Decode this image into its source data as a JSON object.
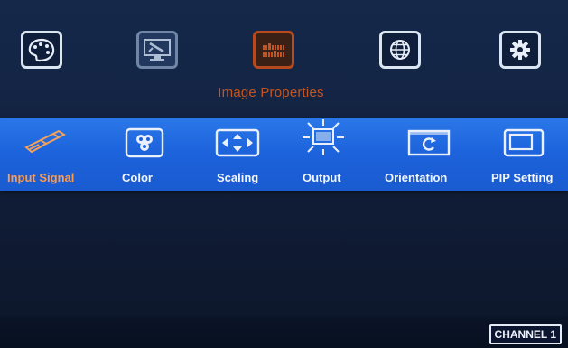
{
  "top_menu": {
    "items": [
      {
        "icon": "palette-icon",
        "state": "normal"
      },
      {
        "icon": "monitor-tools-icon",
        "state": "dim"
      },
      {
        "icon": "image-properties-icon",
        "state": "active"
      },
      {
        "icon": "globe-icon",
        "state": "normal"
      },
      {
        "icon": "gear-icon",
        "state": "normal"
      }
    ],
    "active_title": "Image Properties"
  },
  "submenu": {
    "items": [
      {
        "label": "Input Signal",
        "icon": "usb-plug-icon",
        "active": true
      },
      {
        "label": "Color",
        "icon": "rgb-circles-icon",
        "active": false
      },
      {
        "label": "Scaling",
        "icon": "expand-arrows-icon",
        "active": false
      },
      {
        "label": "Output",
        "icon": "monitor-rays-icon",
        "active": false
      },
      {
        "label": "Orientation",
        "icon": "rotate-screen-icon",
        "active": false
      },
      {
        "label": "PIP Setting",
        "icon": "pip-window-icon",
        "active": false
      }
    ]
  },
  "status": {
    "channel_label": "CHANNEL 1"
  },
  "colors": {
    "band": "#1c62db",
    "active": "#c55520",
    "active_label": "#ff9a4a",
    "background": "#142545"
  }
}
